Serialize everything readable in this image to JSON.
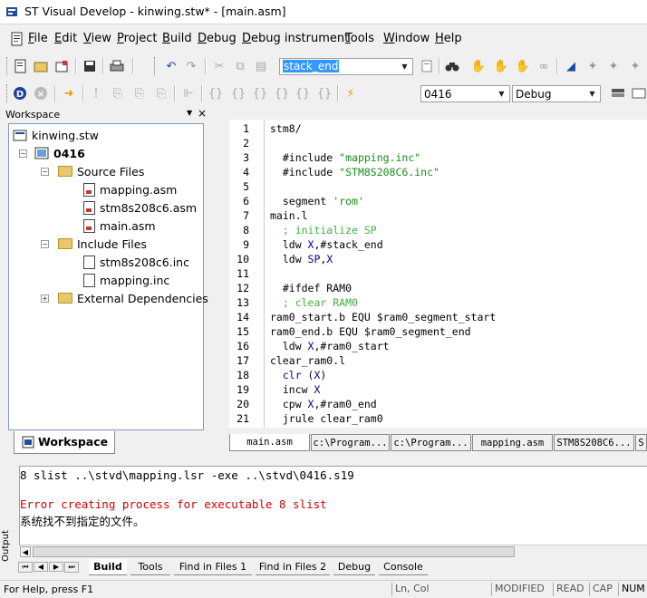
{
  "window": {
    "title": "ST Visual Develop - kinwing.stw* - [main.asm]"
  },
  "menu": [
    "File",
    "Edit",
    "View",
    "Project",
    "Build",
    "Debug",
    "Debug instrument",
    "Tools",
    "Window",
    "Help"
  ],
  "menu_underline": [
    "F",
    "E",
    "V",
    "P",
    "B",
    "D",
    "D",
    "T",
    "W",
    "H"
  ],
  "toolbar": {
    "find_text": "stack_end",
    "project_combo": "0416",
    "config_combo": "Debug"
  },
  "workspace": {
    "header": "Workspace",
    "tab_label": "Workspace",
    "tree": {
      "root": "kinwing.stw",
      "project": "0416",
      "source_folder": "Source Files",
      "source_files": [
        "mapping.asm",
        "stm8s208c6.asm",
        "main.asm"
      ],
      "include_folder": "Include Files",
      "include_files": [
        "stm8s208c6.inc",
        "mapping.inc"
      ],
      "external_folder": "External Dependencies"
    }
  },
  "editor": {
    "lines": [
      {
        "n": "1",
        "segs": [
          {
            "t": "stm8/",
            "c": ""
          }
        ]
      },
      {
        "n": "2",
        "segs": []
      },
      {
        "n": "3",
        "segs": [
          {
            "t": "  #include ",
            "c": ""
          },
          {
            "t": "\"mapping.inc\"",
            "c": "str"
          }
        ]
      },
      {
        "n": "4",
        "segs": [
          {
            "t": "  #include ",
            "c": ""
          },
          {
            "t": "\"STM8S208C6.inc\"",
            "c": "str"
          }
        ]
      },
      {
        "n": "5",
        "segs": []
      },
      {
        "n": "6",
        "segs": [
          {
            "t": "  segment ",
            "c": ""
          },
          {
            "t": "'rom'",
            "c": "str"
          }
        ]
      },
      {
        "n": "7",
        "segs": [
          {
            "t": "main.l",
            "c": ""
          }
        ]
      },
      {
        "n": "8",
        "segs": [
          {
            "t": "  ; initialize SP",
            "c": "cmt"
          }
        ]
      },
      {
        "n": "9",
        "segs": [
          {
            "t": "  ldw ",
            "c": ""
          },
          {
            "t": "X",
            "c": "kw"
          },
          {
            "t": ",#stack_end",
            "c": ""
          }
        ]
      },
      {
        "n": "10",
        "segs": [
          {
            "t": "  ldw ",
            "c": ""
          },
          {
            "t": "SP",
            "c": "kw"
          },
          {
            "t": ",",
            "c": ""
          },
          {
            "t": "X",
            "c": "kw"
          }
        ]
      },
      {
        "n": "11",
        "segs": []
      },
      {
        "n": "12",
        "segs": [
          {
            "t": "  #ifdef RAM0",
            "c": ""
          }
        ]
      },
      {
        "n": "13",
        "segs": [
          {
            "t": "  ; clear RAM0",
            "c": "cmt"
          }
        ]
      },
      {
        "n": "14",
        "segs": [
          {
            "t": "ram0_start.b EQU $ram0_segment_start",
            "c": ""
          }
        ]
      },
      {
        "n": "15",
        "segs": [
          {
            "t": "ram0_end.b EQU $ram0_segment_end",
            "c": ""
          }
        ]
      },
      {
        "n": "16",
        "segs": [
          {
            "t": "  ldw ",
            "c": ""
          },
          {
            "t": "X",
            "c": "kw"
          },
          {
            "t": ",#ram0_start",
            "c": ""
          }
        ]
      },
      {
        "n": "17",
        "segs": [
          {
            "t": "clear_ram0.l",
            "c": ""
          }
        ]
      },
      {
        "n": "18",
        "segs": [
          {
            "t": "  clr ",
            "c": "kw"
          },
          {
            "t": "(",
            "c": ""
          },
          {
            "t": "X",
            "c": "kw"
          },
          {
            "t": ")",
            "c": ""
          }
        ]
      },
      {
        "n": "19",
        "segs": [
          {
            "t": "  incw ",
            "c": ""
          },
          {
            "t": "X",
            "c": "kw"
          }
        ]
      },
      {
        "n": "20",
        "segs": [
          {
            "t": "  cpw ",
            "c": ""
          },
          {
            "t": "X",
            "c": "kw"
          },
          {
            "t": ",#ram0_end",
            "c": ""
          }
        ]
      },
      {
        "n": "21",
        "segs": [
          {
            "t": "  jrule clear_ram0",
            "c": ""
          }
        ]
      }
    ],
    "tabs": [
      "main.asm",
      "c:\\Program...",
      "c:\\Program...",
      "mapping.asm",
      "STM8S208C6...",
      "S"
    ]
  },
  "output": {
    "lines": [
      {
        "t": "8 slist ..\\stvd\\mapping.lsr -exe ..\\stvd\\0416.s19",
        "color": "#000000"
      },
      {
        "t": "",
        "color": "#000000"
      },
      {
        "t": "Error creating process for executable 8 slist",
        "color": "#d00000"
      },
      {
        "t": "系统找不到指定的文件。",
        "color": "#000000"
      }
    ],
    "side_label": "Output",
    "tabs": [
      "Build",
      "Tools",
      "Find in Files 1",
      "Find in Files 2",
      "Debug",
      "Console"
    ]
  },
  "status": {
    "help": "For Help, press F1",
    "position": "Ln, Col",
    "modified": "MODIFIED",
    "read": "READ",
    "cap": "CAP",
    "num": "NUM"
  },
  "colors": {
    "error": "#d00000",
    "string": "#1a8a1a",
    "comment": "#40b040",
    "keyword": "#00008b",
    "selection": "#3399ff"
  }
}
